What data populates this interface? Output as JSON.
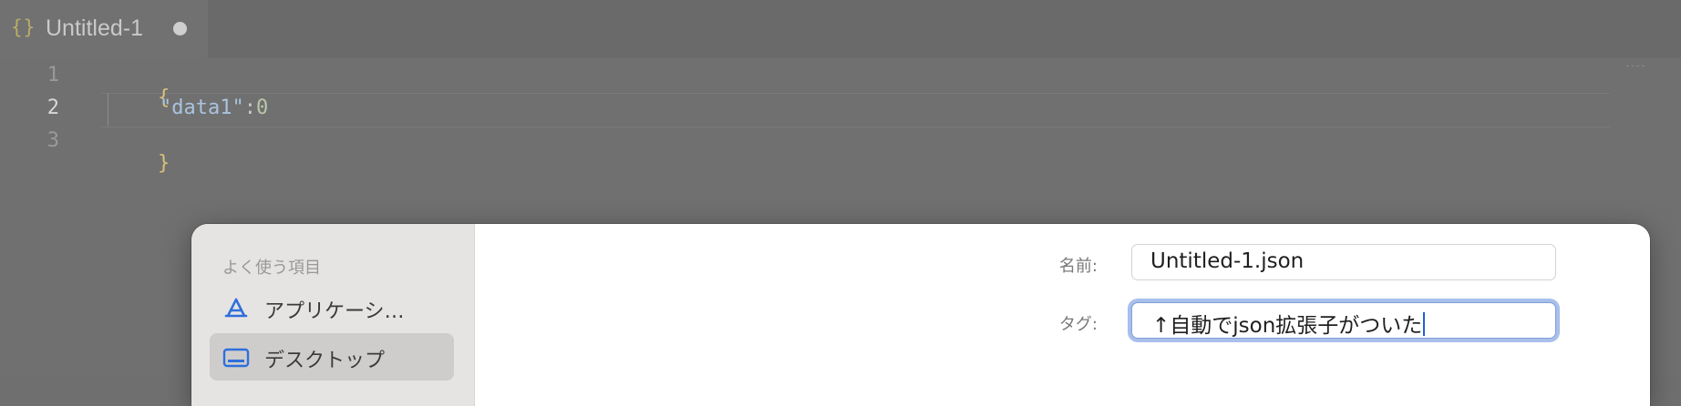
{
  "editor": {
    "tab": {
      "icon": "{}",
      "title": "Untitled-1"
    },
    "lines": [
      {
        "number": "1",
        "brace": "{"
      },
      {
        "number": "2",
        "key": "\"data1\"",
        "colon": ":",
        "value": "0"
      },
      {
        "number": "3",
        "brace": "}"
      }
    ]
  },
  "save_dialog": {
    "sidebar": {
      "heading": "よく使う項目",
      "items": [
        {
          "label": "アプリケーシ…",
          "icon": "applications-icon"
        },
        {
          "label": "デスクトップ",
          "icon": "desktop-icon"
        }
      ]
    },
    "form": {
      "name_label": "名前:",
      "name_value": "Untitled-1.json",
      "tags_label": "タグ:",
      "tags_value": "↑自動でjson拡張子がついた"
    }
  },
  "colors": {
    "accent": "#1f5fd1",
    "focus_ring": "#a9bfec",
    "dim_overlay": "#707070"
  }
}
